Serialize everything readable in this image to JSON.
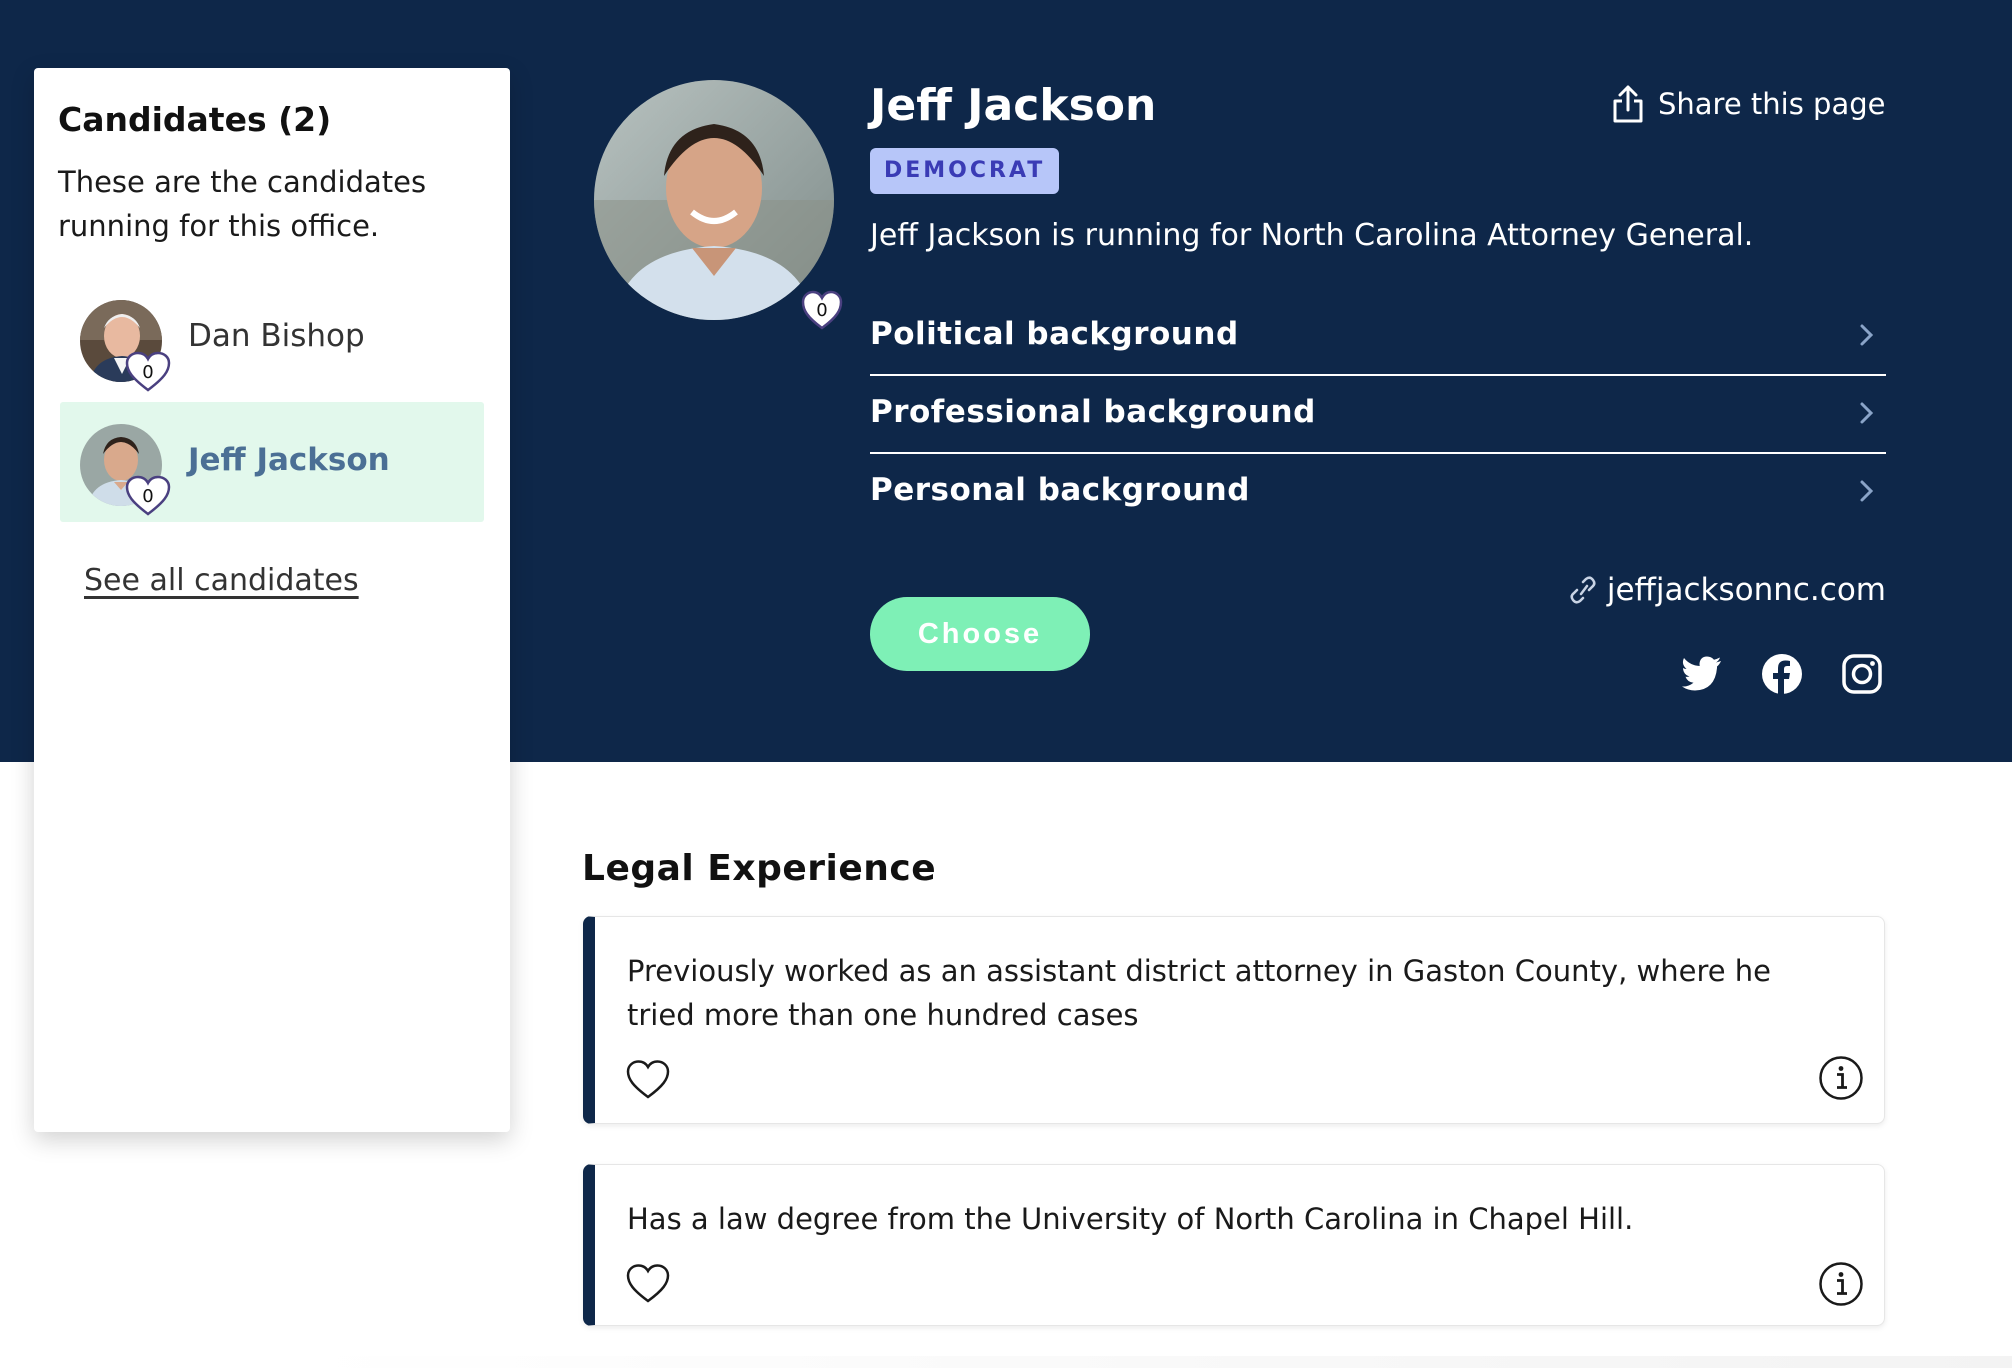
{
  "sidebar": {
    "title": "Candidates (2)",
    "description": "These are the candidates running for this office.",
    "candidates": [
      {
        "name": "Dan Bishop",
        "hearts": "0",
        "active": false
      },
      {
        "name": "Jeff Jackson",
        "hearts": "0",
        "active": true
      }
    ],
    "see_all": "See all candidates"
  },
  "profile": {
    "name": "Jeff Jackson",
    "party": "DEMOCRAT",
    "summary": "Jeff Jackson is running for North Carolina Attorney General.",
    "hearts": "0",
    "share_label": "Share this page",
    "accordion": [
      "Political background",
      "Professional background",
      "Personal background"
    ],
    "choose_label": "Choose",
    "website": "jeffjacksonnc.com",
    "social_icons": [
      "twitter-icon",
      "facebook-icon",
      "instagram-icon"
    ]
  },
  "experience": {
    "title": "Legal Experience",
    "items": [
      "Previously worked as an assistant district attorney in Gaston County, where he tried more than one hundred cases",
      "Has a law degree from the University of North Carolina in Chapel Hill."
    ]
  },
  "colors": {
    "navy": "#0e2749",
    "party_badge": "#b7c6f9",
    "party_text": "#3a3bb5",
    "choose_button": "#7ef0b6",
    "active_candidate_bg": "#e2f8ec"
  }
}
